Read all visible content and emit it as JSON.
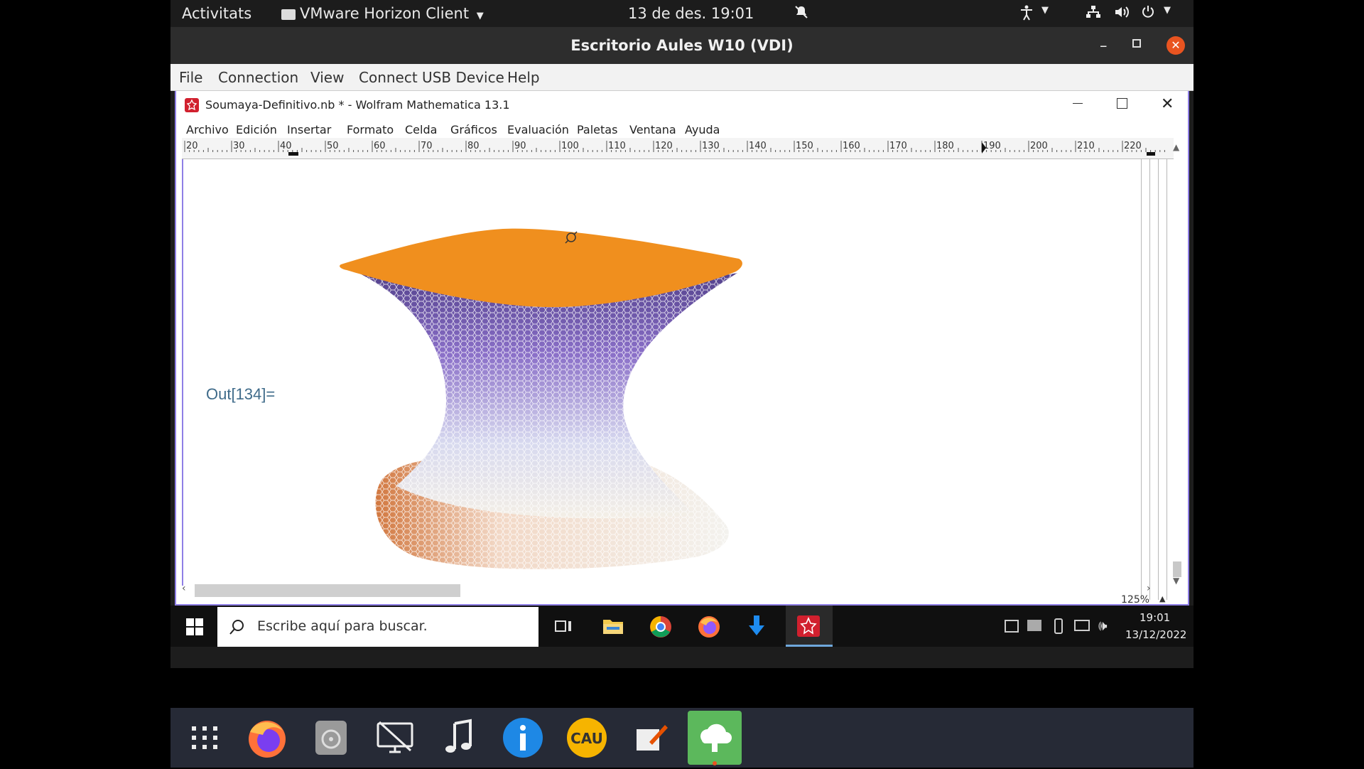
{
  "gnome_bar": {
    "activities": "Activitats",
    "app_menu": "VMware Horizon Client",
    "clock": "13 de des.  19:01"
  },
  "horizon": {
    "title": "Escritorio Aules W10 (VDI)",
    "menu": [
      "File",
      "Connection",
      "View",
      "Connect USB Device",
      "Help"
    ]
  },
  "mathematica": {
    "title": "Soumaya-Definitivo.nb * - Wolfram Mathematica 13.1",
    "menu": [
      "Archivo",
      "Edición",
      "Insertar",
      "Formato",
      "Celda",
      "Gráficos",
      "Evaluación",
      "Paletas",
      "Ventana",
      "Ayuda"
    ],
    "ruler_labels": [
      "20",
      "30",
      "40",
      "50",
      "60",
      "70",
      "80",
      "90",
      "100",
      "110",
      "120",
      "130",
      "140",
      "150",
      "160",
      "170",
      "180",
      "190",
      "200",
      "210",
      "220"
    ],
    "output_label": "Out[134]=",
    "zoom": "125%"
  },
  "taskbar": {
    "search_placeholder": "Escribe aquí para buscar.",
    "time": "19:01",
    "date": "13/12/2022"
  },
  "dock": {
    "icons": [
      "apps-grid-icon",
      "firefox-icon",
      "disk-icon",
      "remote-desktop-icon",
      "music-icon",
      "info-icon",
      "cau-icon",
      "edit-icon",
      "horizon-client-icon"
    ]
  },
  "colors": {
    "surface_top": "#f08f1e",
    "surface_mesh": "#7d5bb8",
    "accent": "#8f7fe6"
  }
}
